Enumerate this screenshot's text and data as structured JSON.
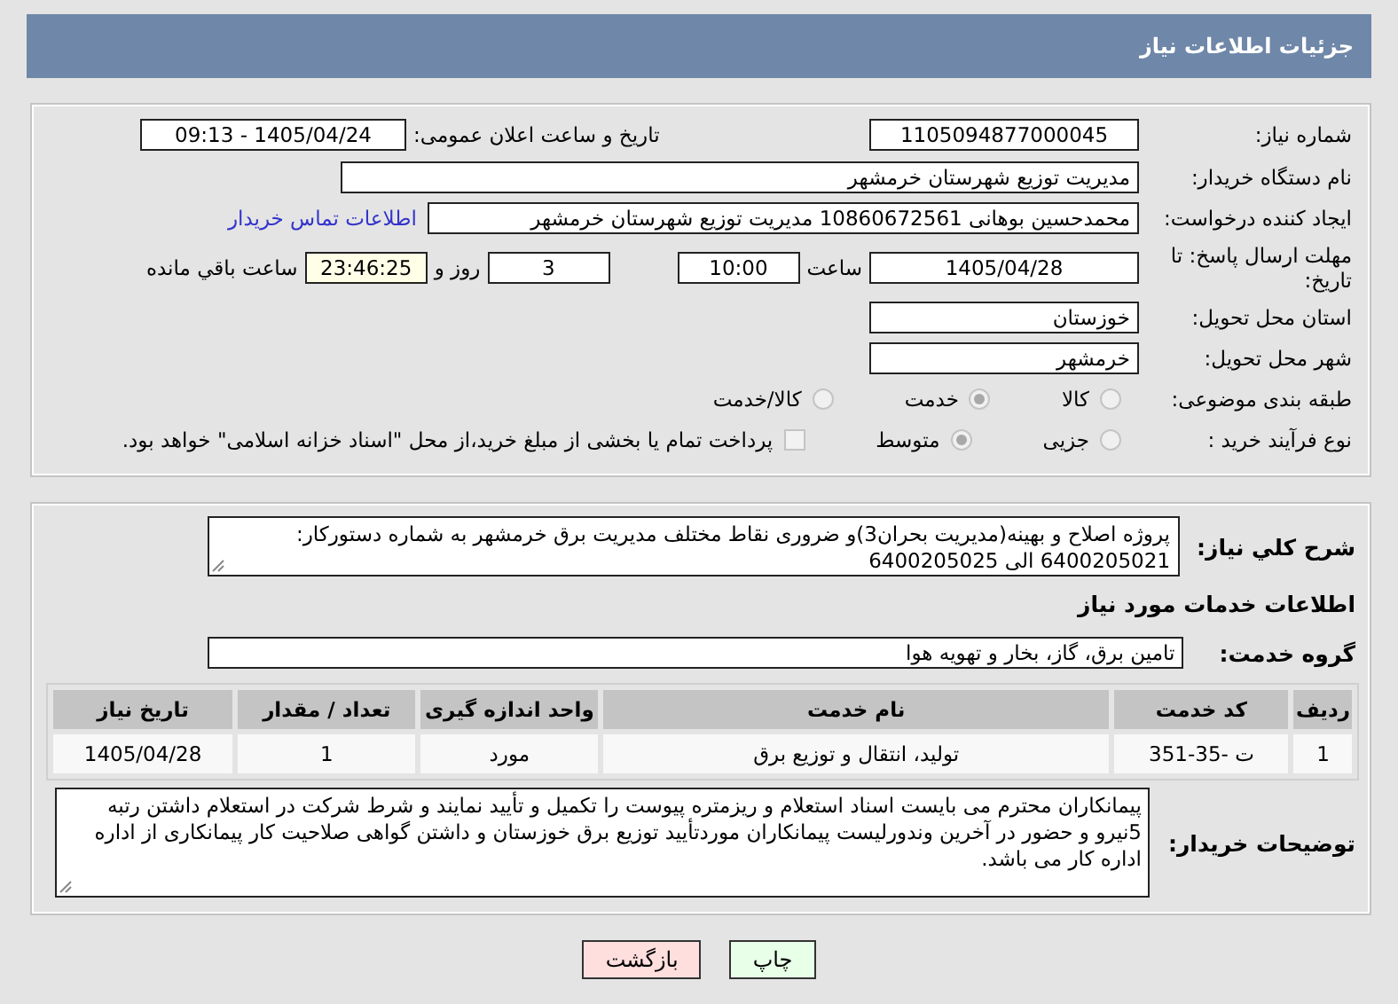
{
  "header": {
    "title": "جزئیات اطلاعات نیاز"
  },
  "details": {
    "need_number": {
      "label": "شماره نیاز:",
      "value": "1105094877000045"
    },
    "announce": {
      "label": "تاریخ و ساعت اعلان عمومی:",
      "value": "1405/04/24 - 09:13"
    },
    "buyer": {
      "label": "نام دستگاه خریدار:",
      "value": "مدیریت توزیع شهرستان خرمشهر"
    },
    "creator": {
      "label": "ایجاد کننده درخواست:",
      "value": "محمدحسین بوهانی 10860672561 مدیریت توزیع شهرستان خرمشهر",
      "link": "اطلاعات تماس خریدار"
    },
    "deadline": {
      "label": "مهلت ارسال پاسخ: تا تاریخ:",
      "date": "1405/04/28",
      "time_label": "ساعت",
      "time": "10:00",
      "days": "3",
      "days_label": "روز و",
      "remaining": "23:46:25",
      "remaining_label": "ساعت باقي مانده"
    },
    "province": {
      "label": "استان محل تحویل:",
      "value": "خوزستان"
    },
    "city": {
      "label": "شهر محل تحویل:",
      "value": "خرمشهر"
    },
    "category": {
      "label": "طبقه بندی موضوعی:",
      "options": [
        {
          "label": "کالا",
          "selected": false
        },
        {
          "label": "خدمت",
          "selected": true
        },
        {
          "label": "کالا/خدمت",
          "selected": false
        }
      ]
    },
    "process": {
      "label": "نوع فرآیند خرید :",
      "options": [
        {
          "label": "جزیی",
          "selected": false
        },
        {
          "label": "متوسط",
          "selected": true
        }
      ],
      "treasury": {
        "label": "پرداخت تمام یا بخشی از مبلغ خرید،از محل \"اسناد خزانه اسلامی\" خواهد بود.",
        "checked": false
      }
    }
  },
  "description": {
    "label": "شرح کلي نیاز:",
    "value": "پروژه اصلاح و بهینه(مدیریت بحران3)و ضروری نقاط مختلف مدیریت برق خرمشهر به شماره دستورکار: 6400205021 الی 6400205025"
  },
  "services": {
    "title": "اطلاعات خدمات مورد نیاز",
    "group_label": "گروه خدمت:",
    "group": "تامین برق، گاز، بخار و تهویه هوا",
    "table": {
      "columns": [
        "ردیف",
        "کد خدمت",
        "نام خدمت",
        "واحد اندازه گیری",
        "تعداد / مقدار",
        "تاریخ نیاز"
      ],
      "rows": [
        [
          "1",
          "ت -35-351",
          "تولید، انتقال و توزیع برق",
          "مورد",
          "1",
          "1405/04/28"
        ]
      ]
    }
  },
  "buyer_notes": {
    "label": "توضیحات خریدار:",
    "value": "پیمانکاران محترم می بایست اسناد استعلام و ریزمتره پیوست را تکمیل و تأیید نمایند و شرط شرکت در استعلام داشتن رتبه 5نیرو و حضور در آخرین وندورلیست پیمانکاران موردتأیید توزیع برق خوزستان و داشتن گواهی صلاحیت کار پیمانکاری از اداره اداره کار می باشد."
  },
  "buttons": [
    {
      "label": "چاپ",
      "kind": "print"
    },
    {
      "label": "بازگشت",
      "kind": "back"
    }
  ]
}
